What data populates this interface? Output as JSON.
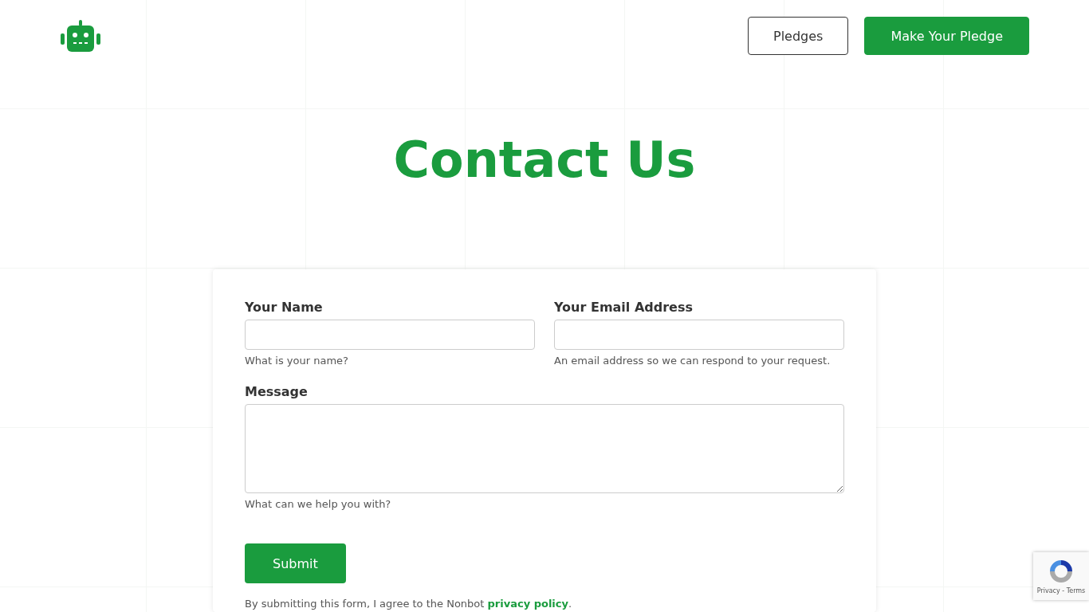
{
  "header": {
    "buttons": [
      {
        "label": "Pledges",
        "kind": "outline"
      },
      {
        "label": "Make Your Pledge",
        "kind": "primary"
      }
    ]
  },
  "title": "Contact Us",
  "form": {
    "fields": [
      {
        "label": "Your Name",
        "hint": "What is your name?",
        "kind": "input"
      },
      {
        "label": "Your Email Address",
        "hint": "An email address so we can respond to your request.",
        "kind": "input"
      },
      {
        "label": "Message",
        "hint": "What can we help you with?",
        "kind": "textarea"
      }
    ],
    "submit": "Submit",
    "consent": {
      "text": "By submitting this form, I agree to the Nonbot ",
      "link": "privacy policy",
      "end": "."
    }
  },
  "recaptcha": {
    "links": "Privacy - Terms"
  }
}
